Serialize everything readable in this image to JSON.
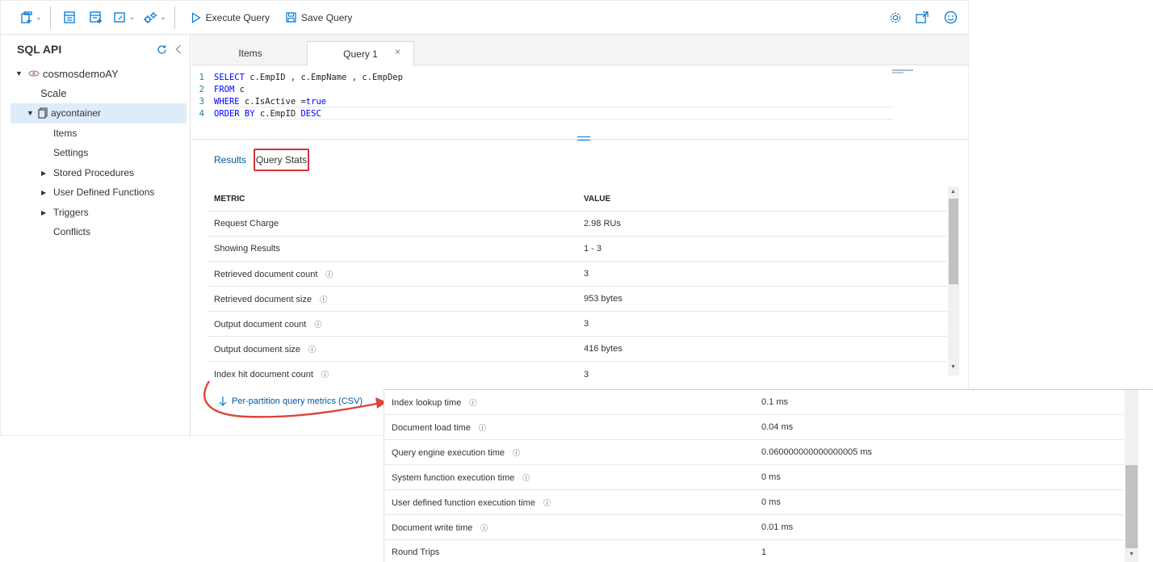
{
  "toolbar": {
    "execute_query": "Execute Query",
    "save_query": "Save Query"
  },
  "sidebar": {
    "title": "SQL API",
    "account": "cosmosdemoAY",
    "scale": "Scale",
    "container": "aycontainer",
    "items": [
      {
        "label": "Items"
      },
      {
        "label": "Settings"
      },
      {
        "label": "Stored Procedures"
      },
      {
        "label": "User Defined Functions"
      },
      {
        "label": "Triggers"
      },
      {
        "label": "Conflicts"
      }
    ]
  },
  "tabs": {
    "items": "Items",
    "query": "Query 1",
    "close": "×"
  },
  "editor": {
    "lines": [
      {
        "n": "1",
        "kw1": "SELECT",
        "rest": " c.EmpID , c.EmpName , c.EmpDep"
      },
      {
        "n": "2",
        "kw1": "FROM",
        "rest": " c"
      },
      {
        "n": "3",
        "kw1": "WHERE",
        "rest": " c.IsActive ",
        "op": "=",
        "kw2": "true"
      },
      {
        "n": "4",
        "kw1": "ORDER BY",
        "rest": " c.EmpID ",
        "kw2": "DESC"
      }
    ]
  },
  "results": {
    "tab_results": "Results",
    "tab_stats": "Query Stats",
    "col_metric": "METRIC",
    "col_value": "VALUE",
    "rows": [
      {
        "metric": "Request Charge",
        "value": "2.98 RUs",
        "info": false
      },
      {
        "metric": "Showing Results",
        "value": "1 - 3",
        "info": false
      },
      {
        "metric": "Retrieved document count",
        "value": "3",
        "info": true
      },
      {
        "metric": "Retrieved document size",
        "value": "953 bytes",
        "info": true
      },
      {
        "metric": "Output document count",
        "value": "3",
        "info": true
      },
      {
        "metric": "Output document size",
        "value": "416 bytes",
        "info": true
      },
      {
        "metric": "Index hit document count",
        "value": "3",
        "info": true
      }
    ],
    "download_link": "Per-partition query metrics (CSV)",
    "info_glyph": "ⓘ"
  },
  "overlay": {
    "rows": [
      {
        "metric": "Index lookup time",
        "value": "0.1 ms"
      },
      {
        "metric": "Document load time",
        "value": "0.04 ms"
      },
      {
        "metric": "Query engine execution time",
        "value": "0.060000000000000005 ms"
      },
      {
        "metric": "System function execution time",
        "value": "0 ms"
      },
      {
        "metric": "User defined function execution time",
        "value": "0 ms"
      },
      {
        "metric": "Document write time",
        "value": "0.01 ms"
      },
      {
        "metric": "Round Trips",
        "value": "1"
      }
    ]
  },
  "colors": {
    "accent": "#0078d4",
    "highlight_border": "#d13438",
    "annotation_arrow": "#d9453b",
    "selected_row": "#deecf9"
  }
}
